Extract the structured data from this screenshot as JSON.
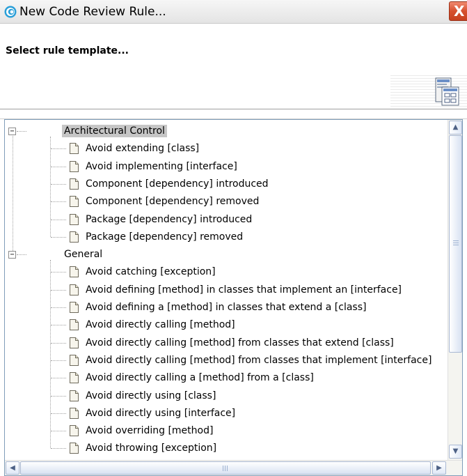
{
  "window": {
    "title": "New Code Review Rule...",
    "close_glyph": "X",
    "app_icon": "eclipse-swirl-icon"
  },
  "banner": {
    "title": "Select rule template...",
    "icon": "rule-template-wizard-icon"
  },
  "tree": {
    "categories": [
      {
        "label": "Architectural Control",
        "expanded": true,
        "selected": true,
        "items": [
          "Avoid extending [class]",
          "Avoid implementing [interface]",
          "Component [dependency] introduced",
          "Component [dependency] removed",
          "Package [dependency] introduced",
          "Package [dependency] removed"
        ]
      },
      {
        "label": "General",
        "expanded": true,
        "selected": false,
        "items": [
          "Avoid catching [exception]",
          "Avoid defining [method] in classes that implement an [interface]",
          "Avoid defining a [method] in classes that extend a [class]",
          "Avoid directly calling [method]",
          "Avoid directly calling [method] from classes that extend [class]",
          "Avoid directly calling [method] from classes that implement [interface]",
          "Avoid directly calling a [method] from a [class]",
          "Avoid directly using [class]",
          "Avoid directly using [interface]",
          "Avoid overriding [method]",
          "Avoid throwing [exception]"
        ]
      }
    ],
    "expander_glyph": "−",
    "item_icon": "document-icon"
  },
  "scrollbars": {
    "up_glyph": "▲",
    "down_glyph": "▼",
    "left_glyph": "◀",
    "right_glyph": "▶"
  }
}
